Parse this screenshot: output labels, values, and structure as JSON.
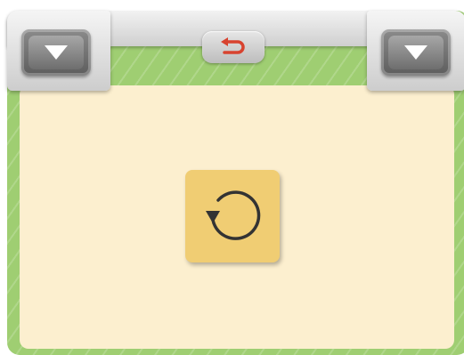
{
  "toolbar": {
    "left_dropdown_icon": "triangle-down-icon",
    "right_dropdown_icon": "triangle-down-icon",
    "back_icon": "undo-arrow-icon"
  },
  "main": {
    "action_icon": "rotate-counterclockwise-icon"
  },
  "colors": {
    "background_green": "#9fce72",
    "panel_cream": "#fcefcf",
    "action_button_yellow": "#f0cd73",
    "back_arrow_red": "#d8432f",
    "toolbar_grey": "#d9d9d9",
    "dropdown_dark": "#6e6e6e"
  }
}
